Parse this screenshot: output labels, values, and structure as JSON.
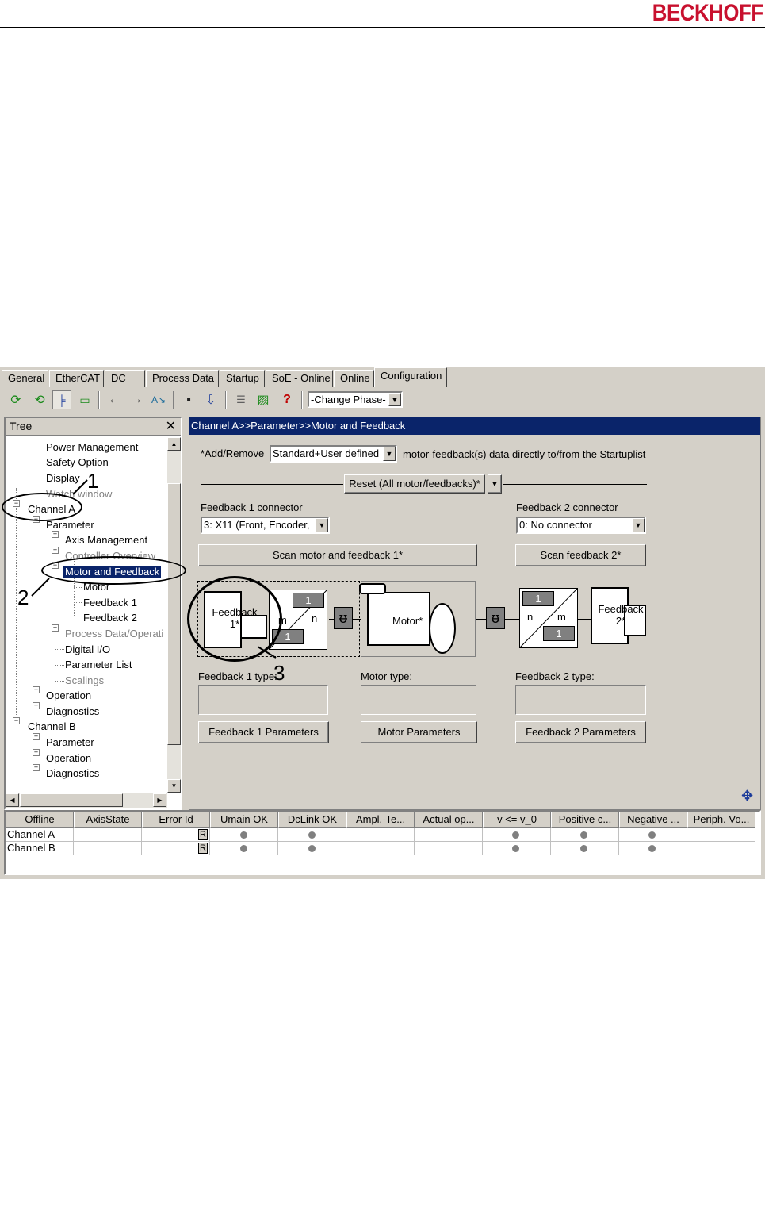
{
  "brand": {
    "logo_text": "BECKHOFF"
  },
  "tabs": [
    "General",
    "EtherCAT",
    "DC",
    "Process Data",
    "Startup",
    "SoE - Online",
    "Online",
    "Configuration"
  ],
  "toolbar": {
    "phase_select": "-Change Phase-"
  },
  "tree": {
    "title": "Tree",
    "close": "✕",
    "items": [
      "Power Management",
      "Safety Option",
      "Display",
      "Watch window",
      "Channel A",
      "Parameter",
      "Axis Management",
      "Controller Overview",
      "Motor and Feedback",
      "Motor",
      "Feedback 1",
      "Feedback 2",
      "Process Data/Operati",
      "Digital I/O",
      "Parameter List",
      "Scalings",
      "Operation",
      "Diagnostics",
      "Channel B",
      "Parameter",
      "Operation",
      "Diagnostics"
    ]
  },
  "main": {
    "breadcrumb": "Channel A>>Parameter>>Motor and Feedback",
    "add_remove_label": "*Add/Remove",
    "add_remove_value": "Standard+User defined",
    "add_remove_suffix": "motor-feedback(s) data directly to/from the Startuplist",
    "reset_button": "Reset (All motor/feedbacks)*",
    "fb1_connector_label": "Feedback 1 connector",
    "fb1_connector_value": "3: X11 (Front, Encoder,",
    "fb2_connector_label": "Feedback 2 connector",
    "fb2_connector_value": "0: No connector",
    "scan_motor_fb1": "Scan motor and feedback 1*",
    "scan_fb2": "Scan feedback 2*",
    "fb1_type_label": "Feedback 1 type:",
    "motor_type_label": "Motor type:",
    "fb2_type_label": "Feedback 2 type:",
    "fb1_params": "Feedback 1 Parameters",
    "motor_params": "Motor Parameters",
    "fb2_params": "Feedback 2 Parameters"
  },
  "diagram": {
    "feedback1": "Feedback 1*",
    "motor": "Motor*",
    "feedback2": "Feedback 2*",
    "ratio_top": "1",
    "ratio_bottom": "1",
    "m": "m",
    "n": "n"
  },
  "grid": {
    "headers": [
      "Offline",
      "AxisState",
      "Error Id",
      "Umain OK",
      "DcLink OK",
      "Ampl.-Te...",
      "Actual op...",
      "v <= v_0",
      "Positive c...",
      "Negative ...",
      "Periph. Vo..."
    ],
    "rows": [
      "Channel A",
      "Channel B"
    ],
    "reset_badge": "R"
  },
  "callouts": [
    "1",
    "2",
    "3"
  ]
}
